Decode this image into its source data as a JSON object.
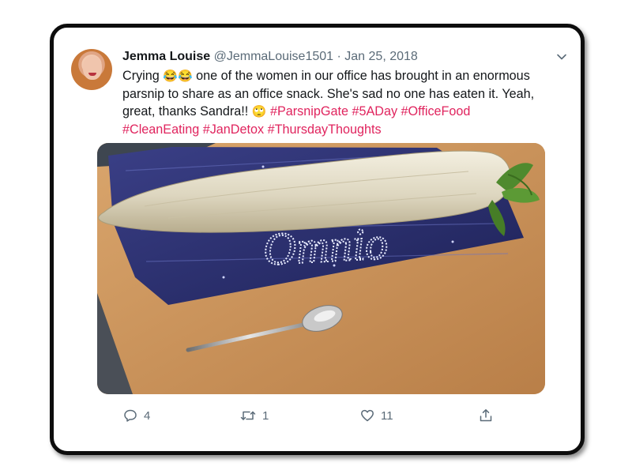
{
  "tweet": {
    "author_name": "Jemma Louise",
    "handle": "@JemmaLouise1501",
    "separator": "·",
    "date": "Jan 25, 2018",
    "text_line1_a": "Crying ",
    "emoji_laugh": "😂😂",
    "text_line1_b": " one of the women in our office has brought in an enormous",
    "text_line2": "parsnip to share as an office snack. She's sad no one has eaten it. Yeah,",
    "text_line3_a": "great, thanks Sandra!! ",
    "emoji_eyeroll": "🙄",
    "hashtags_line3": [
      "#ParsnipGate",
      "#5ADay",
      "#OfficeFood"
    ],
    "hashtags_line4": [
      "#CleanEating",
      "#JanDetox",
      "#ThursdayThoughts"
    ]
  },
  "media": {
    "bag_lettering": "Omnio"
  },
  "actions": {
    "reply_count": "4",
    "retweet_count": "1",
    "like_count": "11"
  },
  "icons": {
    "menu": "chevron-down-icon",
    "reply": "reply-icon",
    "retweet": "retweet-icon",
    "like": "heart-icon",
    "share": "share-icon"
  },
  "colors": {
    "hashtag": "#e0245e",
    "secondary_text": "#5b6b78",
    "primary_text": "#14171a",
    "frame_border": "#0d0d0d"
  }
}
